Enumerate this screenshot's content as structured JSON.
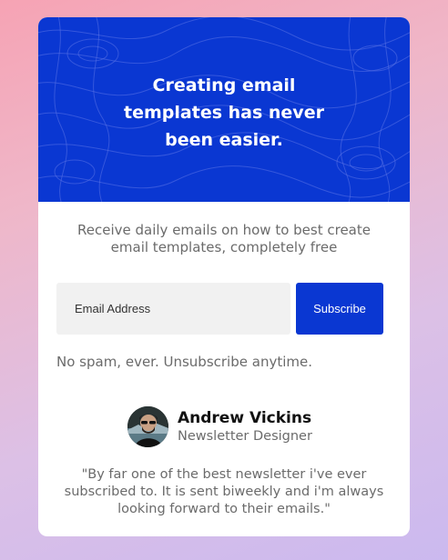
{
  "hero": {
    "title": "Creating email templates has never been easier."
  },
  "intro": {
    "text": "Receive daily emails on how to best create email templates, completely free"
  },
  "form": {
    "email_placeholder": "Email Address",
    "subscribe_label": "Subscribe"
  },
  "disclaimer": "No spam, ever. Unsubscribe anytime.",
  "testimonial": {
    "author_name": "Andrew Vickins",
    "author_role": "Newsletter Designer",
    "quote": "\"By far one of the best newsletter i've ever subscribed to. It is sent biweekly and i'm always looking forward to their emails.\""
  },
  "colors": {
    "accent": "#0a37d2",
    "text_muted": "#6b6b6b",
    "input_bg": "#f1f1f1"
  }
}
